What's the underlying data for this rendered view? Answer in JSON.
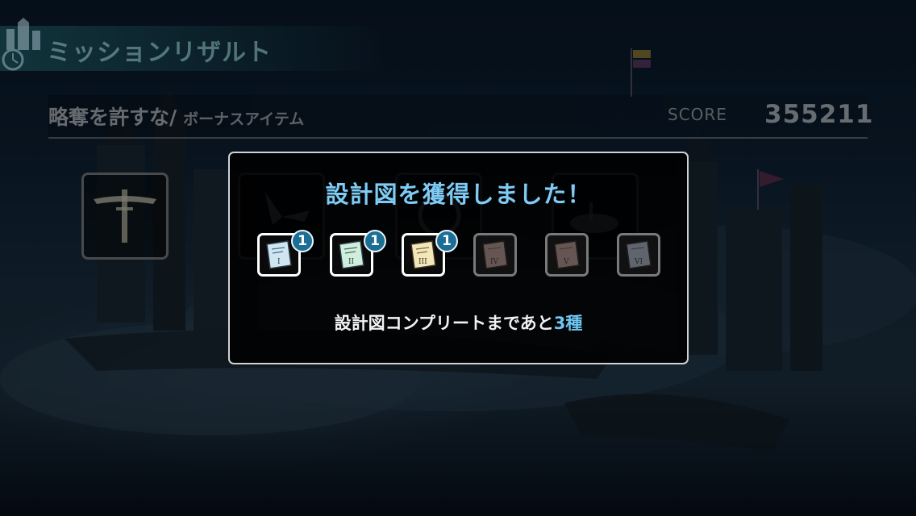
{
  "header": {
    "title": "ミッションリザルト",
    "emblem_icon": "castle-emblem-icon"
  },
  "mission": {
    "name": "略奪を許すな",
    "separator": "/",
    "subtitle": "ボーナスアイテム",
    "score_label": "SCORE",
    "score_value": "355211"
  },
  "bonus_items": [
    {
      "icon": "sword-emblem-icon"
    },
    {
      "icon": "propeller-icon"
    },
    {
      "icon": "orb-icon"
    },
    {
      "icon": "airship-icon"
    }
  ],
  "dialog": {
    "title": "設計図を獲得しました！",
    "blueprints": [
      {
        "numeral": "I",
        "count": "1",
        "owned": true,
        "tint": "#cfe6f2"
      },
      {
        "numeral": "II",
        "count": "1",
        "owned": true,
        "tint": "#cfeedd"
      },
      {
        "numeral": "III",
        "count": "1",
        "owned": true,
        "tint": "#f3e6b8"
      },
      {
        "numeral": "IV",
        "count": "",
        "owned": false,
        "tint": "#8a7470"
      },
      {
        "numeral": "V",
        "count": "",
        "owned": false,
        "tint": "#8a7470"
      },
      {
        "numeral": "VI",
        "count": "",
        "owned": false,
        "tint": "#808894"
      }
    ],
    "complete_prefix": "設計図コンプリートまであと",
    "complete_count": "3種"
  },
  "colors": {
    "accent": "#7ecbf5",
    "badge": "#1c6e95",
    "dialog_border": "#cfd2d4"
  }
}
